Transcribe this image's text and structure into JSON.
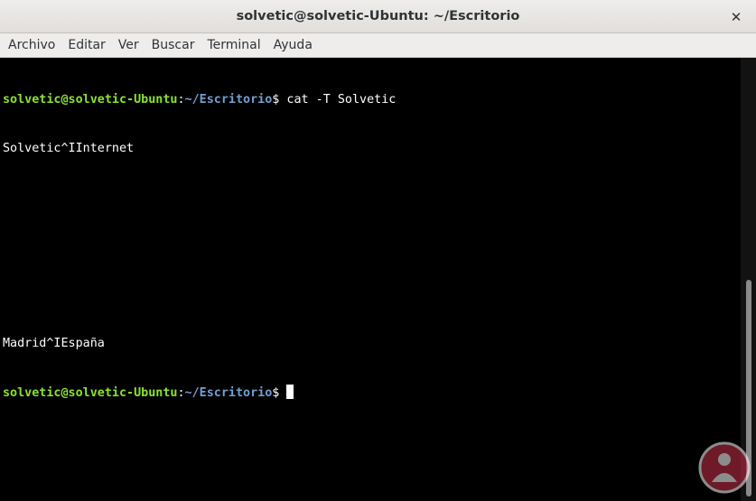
{
  "window": {
    "title": "solvetic@solvetic-Ubuntu: ~/Escritorio",
    "close_glyph": "✕"
  },
  "menubar": {
    "items": [
      {
        "label": "Archivo"
      },
      {
        "label": "Editar"
      },
      {
        "label": "Ver"
      },
      {
        "label": "Buscar"
      },
      {
        "label": "Terminal"
      },
      {
        "label": "Ayuda"
      }
    ]
  },
  "terminal": {
    "prompt_user": "solvetic@solvetic-Ubuntu",
    "prompt_sep": ":",
    "prompt_path": "~/Escritorio",
    "prompt_dollar": "$ ",
    "command": "cat -T Solvetic",
    "output": [
      "Solvetic^IInternet",
      "",
      "",
      "",
      "Madrid^IEspaña"
    ]
  },
  "colors": {
    "terminal_bg": "#000000",
    "prompt_user": "#8ae234",
    "prompt_path": "#729fcf",
    "text": "#ffffff",
    "watermark": "#c9304a"
  },
  "icons": {
    "close": "close-icon",
    "watermark": "solvetic-logo-icon"
  }
}
